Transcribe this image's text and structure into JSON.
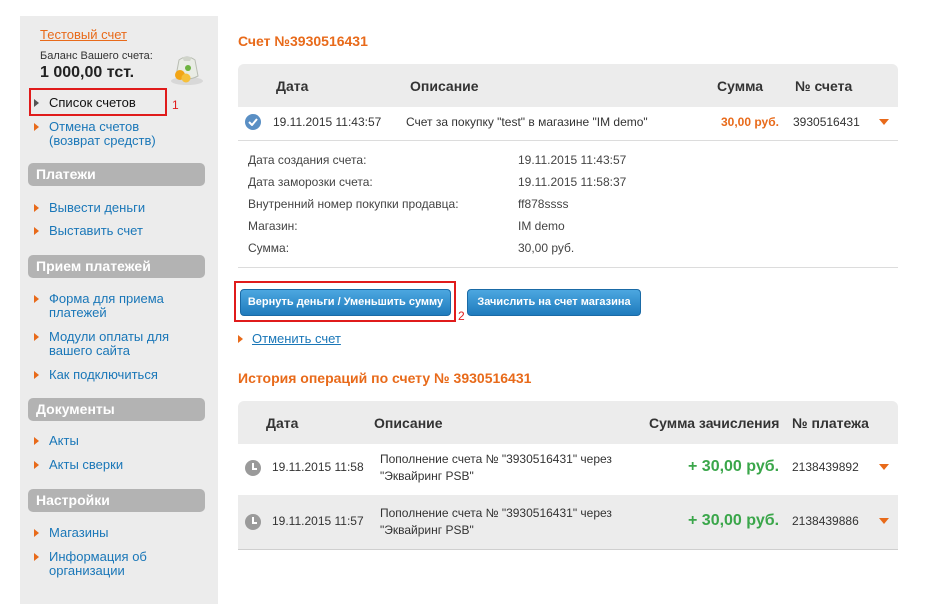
{
  "sidebar": {
    "account_title": "Тестовый счет",
    "balance_label": "Баланс Вашего счета:",
    "balance_value": "1 000,00 тст.",
    "top_items": [
      {
        "label": "Список счетов"
      },
      {
        "label": "Отмена счетов (возврат средств)"
      }
    ],
    "sections": [
      {
        "title": "Платежи",
        "items": [
          {
            "label": "Вывести деньги"
          },
          {
            "label": "Выставить счет"
          }
        ]
      },
      {
        "title": "Прием платежей",
        "items": [
          {
            "label": "Форма для приема платежей"
          },
          {
            "label": "Модули оплаты для вашего сайта"
          },
          {
            "label": "Как подключиться"
          }
        ]
      },
      {
        "title": "Документы",
        "items": [
          {
            "label": "Акты"
          },
          {
            "label": "Акты сверки"
          }
        ]
      },
      {
        "title": "Настройки",
        "items": [
          {
            "label": "Магазины"
          },
          {
            "label": "Информация об организации"
          }
        ]
      }
    ]
  },
  "annotations": {
    "marker1": "1",
    "marker2": "2"
  },
  "invoice": {
    "title": "Счет №3930516431",
    "columns": {
      "date": "Дата",
      "description": "Описание",
      "amount": "Сумма",
      "number": "№ счета"
    },
    "row": {
      "date": "19.11.2015 11:43:57",
      "description": "Счет за покупку \"test\" в магазине \"IM demo\"",
      "amount": "30,00 руб.",
      "number": "3930516431"
    },
    "details": [
      {
        "label": "Дата создания счета:",
        "value": "19.11.2015 11:43:57"
      },
      {
        "label": "Дата заморозки счета:",
        "value": "19.11.2015 11:58:37"
      },
      {
        "label": "Внутренний номер покупки продавца:",
        "value": "ff878ssss"
      },
      {
        "label": "Магазин:",
        "value": "IM demo"
      },
      {
        "label": "Сумма:",
        "value": "30,00 руб."
      }
    ],
    "buttons": {
      "refund": "Вернуть деньги / Уменьшить сумму",
      "credit": "Зачислить на счет магазина"
    },
    "cancel_link": "Отменить счет"
  },
  "history": {
    "title": "История операций по счету № 3930516431",
    "columns": {
      "date": "Дата",
      "description": "Описание",
      "amount": "Сумма зачисления",
      "number": "№ платежа"
    },
    "rows": [
      {
        "date": "19.11.2015 11:58",
        "description_line1": "Пополнение счета № \"3930516431\" через",
        "description_line2": "\"Эквайринг PSB\"",
        "amount": "+ 30,00 руб.",
        "number": "2138439892"
      },
      {
        "date": "19.11.2015 11:57",
        "description_line1": "Пополнение счета № \"3930516431\" через",
        "description_line2": "\"Эквайринг PSB\"",
        "amount": "+ 30,00 руб.",
        "number": "2138439886"
      }
    ]
  },
  "colors": {
    "accent": "#e86a1a",
    "link": "#1a77b8",
    "positive": "#3aa64a",
    "button": "#1f7bbd",
    "highlight": "#e01b1b"
  },
  "icons": [
    "money-bag-icon",
    "check-circle-icon",
    "clock-icon",
    "chevron-down-icon",
    "arrow-right-icon"
  ]
}
